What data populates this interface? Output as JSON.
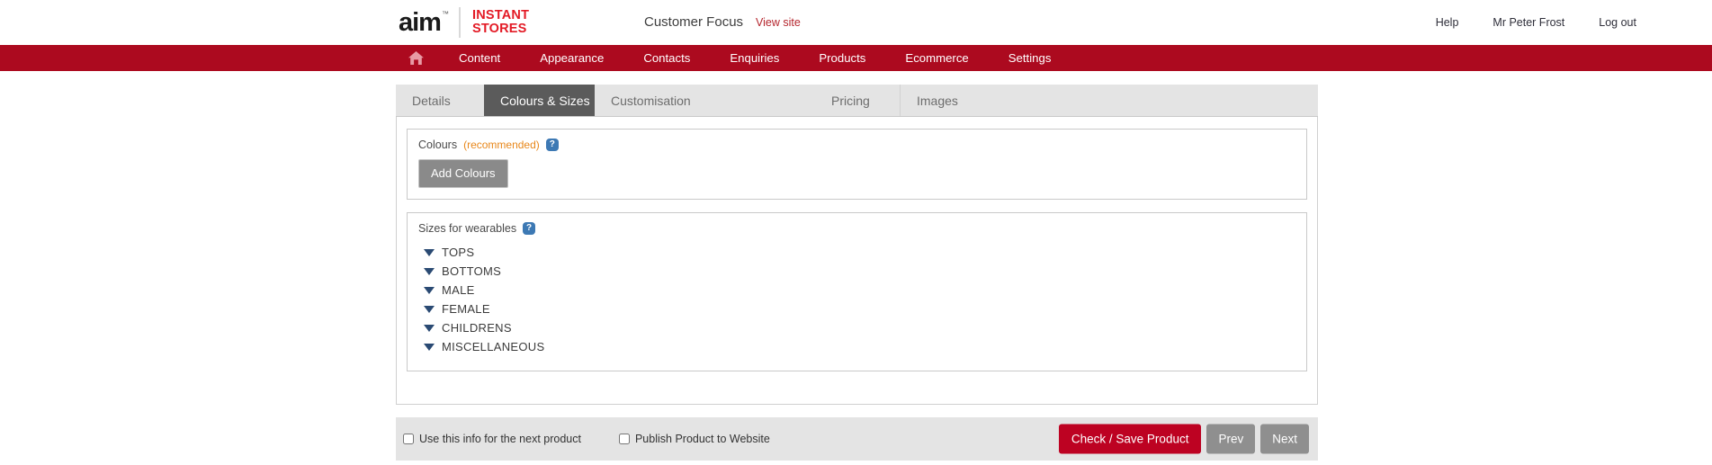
{
  "header": {
    "logo": {
      "brand": "aim",
      "tm": "™",
      "product_line_1": "INSTANT",
      "product_line_2": "STORES"
    },
    "site_name": "Customer Focus",
    "view_site_label": "View site",
    "right_links": [
      {
        "label": "Help"
      },
      {
        "label": "Mr Peter Frost"
      },
      {
        "label": "Log out"
      }
    ]
  },
  "main_nav": {
    "home_icon": "home-icon",
    "items": [
      {
        "label": "Content"
      },
      {
        "label": "Appearance"
      },
      {
        "label": "Contacts"
      },
      {
        "label": "Enquiries"
      },
      {
        "label": "Products"
      },
      {
        "label": "Ecommerce"
      },
      {
        "label": "Settings"
      }
    ]
  },
  "tabs": [
    {
      "label": "Details",
      "active": false
    },
    {
      "label": "Colours & Sizes",
      "active": true
    },
    {
      "label": "Customisation",
      "active": false
    },
    {
      "label": "Pricing",
      "active": false
    },
    {
      "label": "Images",
      "active": false
    }
  ],
  "colours_section": {
    "title": "Colours",
    "recommended": "(recommended)",
    "help_icon": "?",
    "add_button_label": "Add Colours"
  },
  "sizes_section": {
    "title": "Sizes for wearables",
    "help_icon": "?",
    "categories": [
      {
        "label": "TOPS"
      },
      {
        "label": "BOTTOMS"
      },
      {
        "label": "MALE"
      },
      {
        "label": "FEMALE"
      },
      {
        "label": "CHILDRENS"
      },
      {
        "label": "MISCELLANEOUS"
      }
    ]
  },
  "action_bar": {
    "checkbox_next_product": "Use this info for the next product",
    "checkbox_publish": "Publish Product to Website",
    "check_save_label": "Check / Save Product",
    "prev_label": "Prev",
    "next_label": "Next"
  },
  "colors": {
    "brand_red": "#ac0a1f",
    "logo_red": "#e31a25",
    "save_red": "#bd0222",
    "accent_orange": "#e8871a",
    "help_blue": "#3d79b4",
    "triangle_navy": "#2a4a73",
    "tab_active_gray": "#5b5b5b",
    "panel_gray": "#e4e4e4"
  }
}
